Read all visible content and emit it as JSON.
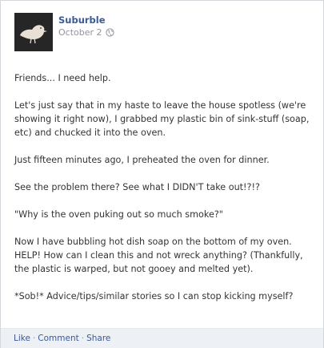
{
  "post": {
    "author": "Suburble",
    "date": "October 2",
    "privacy_icon": "globe-icon",
    "avatar_icon": "bird-icon",
    "paragraphs": [
      [
        "Friends... I need help."
      ],
      [
        "Let's just say that in my haste to leave the house spotless (we're",
        "showing it right now), I grabbed my plastic bin of sink-stuff (soap,",
        "etc) and chucked it into the oven."
      ],
      [
        "Just fifteen minutes ago, I preheated the oven for dinner."
      ],
      [
        "See the problem there? See what I DIDN'T take out!?!?"
      ],
      [
        "\"Why is the oven puking out so much smoke?\""
      ],
      [
        "Now I have bubbling hot dish soap on the bottom of my oven.",
        "HELP! How can I clean this and not wreck anything? (Thankfully,",
        "the plastic is warped, but not gooey and melted yet)."
      ],
      [
        "*Sob!* Advice/tips/similar stories so I can stop kicking myself?"
      ]
    ]
  },
  "footer": {
    "like": "Like",
    "comment": "Comment",
    "share": "Share",
    "separator": "·"
  },
  "colors": {
    "link": "#3b5998",
    "meta": "#90949c",
    "footer_bg": "#edf0f5",
    "avatar_bg": "#262626",
    "bird": "#e8e0d4"
  }
}
